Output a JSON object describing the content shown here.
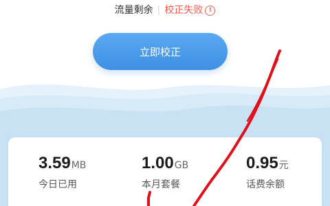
{
  "status": {
    "label": "流量剩余",
    "separator": "|",
    "fail_text": "校正失败",
    "warn_icon": "exclamation-circle-icon",
    "warn_glyph": "!"
  },
  "calibrate_button": {
    "label": "立即校正"
  },
  "stats": [
    {
      "value": "3.59",
      "unit": "MB",
      "label": "今日已用"
    },
    {
      "value": "1.00",
      "unit": "GB",
      "label": "本月套餐"
    },
    {
      "value": "0.95",
      "unit": "元",
      "label": "话费余额"
    }
  ],
  "colors": {
    "accent": "#4a9ae8",
    "fail": "#f05a4a",
    "wave": "#cfe6f5",
    "scribble": "#e0101a"
  }
}
